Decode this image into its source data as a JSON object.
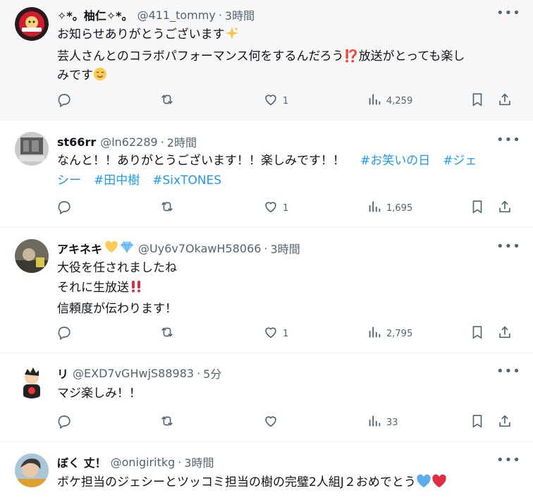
{
  "posts": [
    {
      "name": "✧*。柚仁✧*。",
      "handle": "@411_tommy",
      "sep": "·",
      "time": "3時間",
      "lines": [
        "お知らせありがとうございます",
        "芸人さんとのコラボパフォーマンス何をするんだろう⁉️放送がとっても楽し",
        "みです"
      ],
      "likes": "1",
      "views": "4,259",
      "highlighted": true
    },
    {
      "name": "st66rr",
      "handle": "@ln62289",
      "sep": "·",
      "time": "2時間",
      "lines": [
        "なんと！！ありがとうございます！！楽しみです！！"
      ],
      "hashtags": [
        "#お笑いの日",
        "#ジェ",
        "シー",
        "#田中樹",
        "#SixTONES"
      ],
      "likes": "1",
      "views": "1,695"
    },
    {
      "name": "アキネキ",
      "handle": "@Uy6v7OkawH58066",
      "sep": "·",
      "time": "3時間",
      "lines": [
        "大役を任されましたね",
        "それに生放送",
        "信頼度が伝わります！"
      ],
      "likes": "1",
      "views": "2,795"
    },
    {
      "name": "リ",
      "handle": "@EXD7vGHwjS88983",
      "sep": "·",
      "time": "5分",
      "lines": [
        "マジ楽しみ！！"
      ],
      "likes": "",
      "views": "33"
    },
    {
      "name": "ぼく 丈！",
      "handle": "@onigiritkg",
      "sep": "·",
      "time": "3時間",
      "lines": [
        "ボケ担当のジェシーとツッコミ担当の樹の完璧2人組J２おめでとう"
      ],
      "likes": "",
      "views": ""
    }
  ],
  "ui": {
    "more": "•••"
  },
  "icons": [
    "reply-icon",
    "repost-icon",
    "like-icon",
    "views-icon",
    "bookmark-icon",
    "share-icon"
  ],
  "colors": {
    "accent": "#1d9bf0",
    "secondary": "#536471",
    "text": "#0f1419"
  }
}
